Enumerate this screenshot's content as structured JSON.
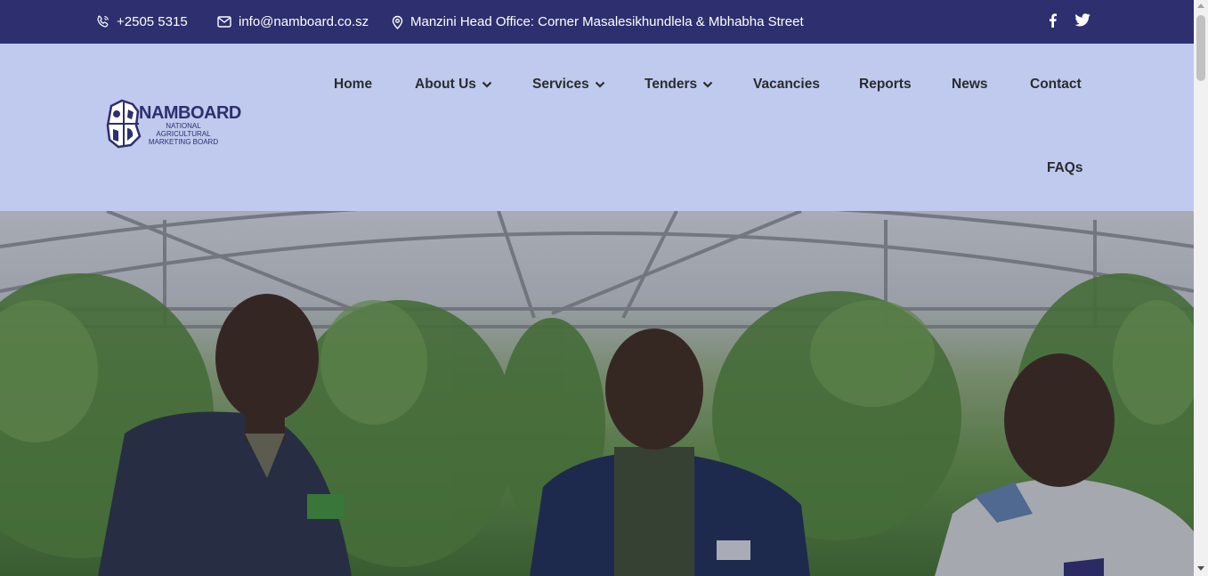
{
  "topbar": {
    "phone": "+2505 5315",
    "email": "info@namboard.co.sz",
    "address": "Manzini Head Office: Corner Masalesikhundlela & Mbhabha Street",
    "social": [
      "facebook-icon",
      "twitter-icon"
    ]
  },
  "logo": {
    "name": "NAMBOARD",
    "subtitle_line1": "NATIONAL AGRICULTURAL",
    "subtitle_line2": "MARKETING BOARD"
  },
  "nav": {
    "home": "Home",
    "about": "About Us",
    "services": "Services",
    "tenders": "Tenders",
    "vacancies": "Vacancies",
    "reports": "Reports",
    "news": "News",
    "contact": "Contact",
    "faqs": "FAQs"
  },
  "colors": {
    "topbar_bg": "#2d2f6e",
    "navbar_bg": "#bfcaee",
    "nav_text": "#2b2b2b",
    "brand": "#2d2f6e"
  }
}
